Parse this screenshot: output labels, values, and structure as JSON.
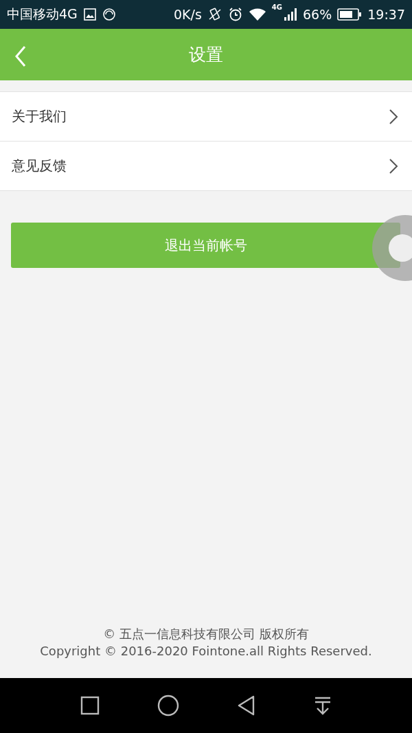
{
  "status_bar": {
    "carrier": "中国移动4G",
    "speed": "0K/s",
    "network": "4G",
    "battery": "66%",
    "time": "19:37"
  },
  "header": {
    "title": "设置"
  },
  "menu": [
    {
      "label": "关于我们"
    },
    {
      "label": "意见反馈"
    }
  ],
  "logout_button": {
    "label": "退出当前帐号"
  },
  "footer": {
    "company": "© 五点一信息科技有限公司 版权所有",
    "copyright": "Copyright © 2016-2020 Fointone.all Rights Reserved."
  }
}
